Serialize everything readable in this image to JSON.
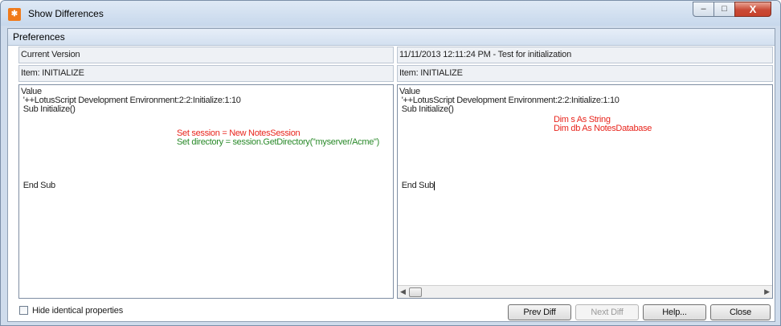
{
  "window": {
    "title": "Show Differences",
    "app_icon": "lotus-notes-icon",
    "controls": {
      "minimize": "–",
      "maximize": "□",
      "close": "X"
    }
  },
  "preferences_label": "Preferences",
  "left_pane": {
    "header": "Current Version",
    "item": "Item: INITIALIZE",
    "lines": {
      "l1": "Value",
      "l2": " '++LotusScript Development Environment:2:2:Initialize:1:10",
      "l3": " Sub Initialize()",
      "l4": "Set session = New NotesSession",
      "l5": "Set directory = session.GetDirectory(\"myserver/Acme\")",
      "l6": " End Sub"
    }
  },
  "right_pane": {
    "header": "11/11/2013 12:11:24 PM - Test for initialization",
    "item": "Item: INITIALIZE",
    "lines": {
      "l1": "Value",
      "l2": " '++LotusScript Development Environment:2:2:Initialize:1:10",
      "l3": " Sub Initialize()",
      "l4": "Dim s As String",
      "l5": "Dim db As NotesDatabase",
      "l6": " End Sub"
    }
  },
  "bottom": {
    "hide_identical_label": "Hide identical properties",
    "hide_identical_checked": false,
    "prev_diff": "Prev Diff",
    "next_diff": "Next Diff",
    "help": "Help...",
    "close": "Close"
  },
  "colors": {
    "added_text": "#2a8a2a",
    "removed_text": "#e8261e"
  }
}
